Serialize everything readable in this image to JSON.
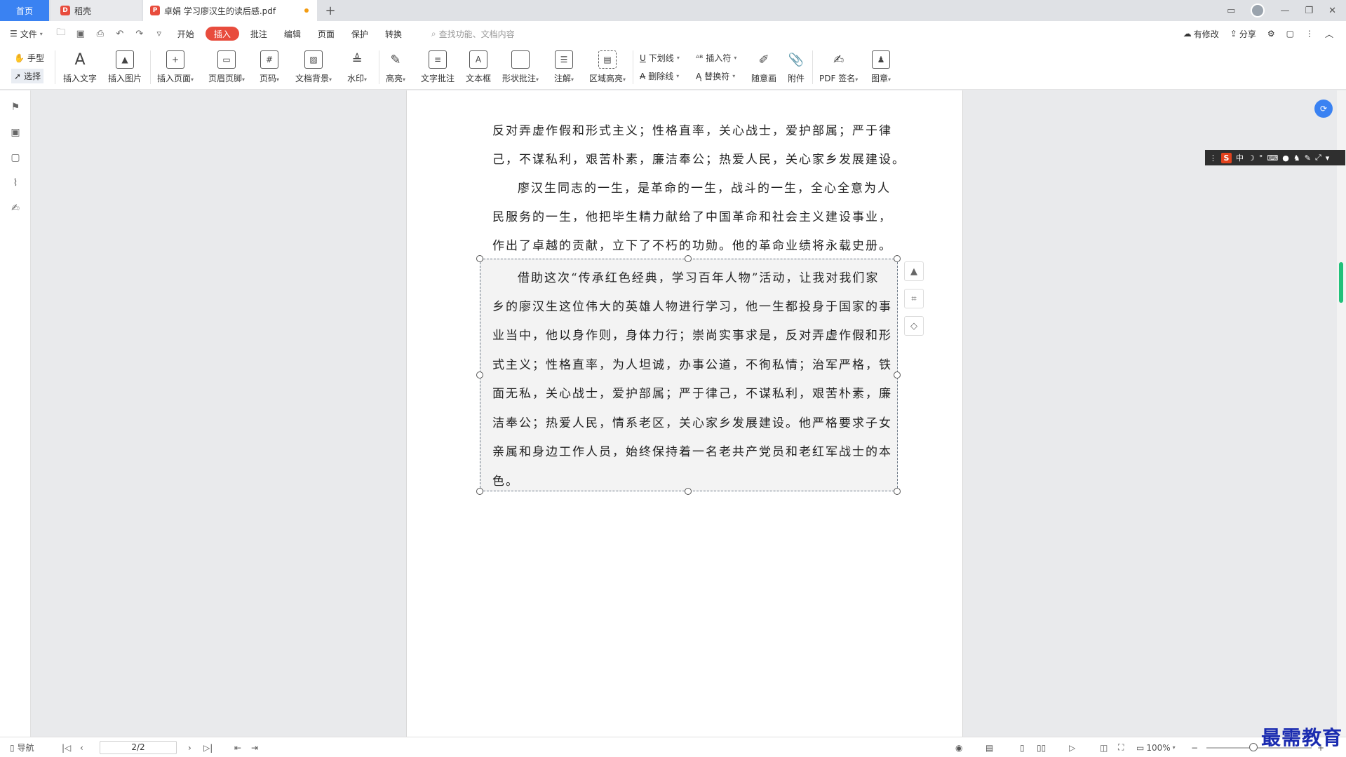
{
  "tabs": {
    "home": "首页",
    "inactive": "稻壳",
    "active": "卓娟 学习廖汉生的读后感.pdf",
    "new_tab": "+"
  },
  "menu": {
    "file": "文件",
    "items": [
      "开始",
      "插入",
      "批注",
      "编辑",
      "页面",
      "保护",
      "转换"
    ],
    "active_index": 1,
    "search_placeholder": "查找功能、文档内容",
    "modified": "有修改",
    "share": "分享"
  },
  "ribbon": {
    "hand": "手型",
    "select": "选择",
    "insert_text": "插入文字",
    "insert_image": "插入图片",
    "insert_page": "插入页面",
    "header_footer": "页眉页脚",
    "page_number": "页码",
    "doc_background": "文档背景",
    "watermark": "水印",
    "highlight": "高亮",
    "text_comment": "文字批注",
    "text_box": "文本框",
    "shape_comment": "形状批注",
    "annotation": "注解",
    "area_highlight": "区域高亮",
    "underline": "下划线",
    "strikethrough": "删除线",
    "insert_char": "插入符",
    "replace_char": "替换符",
    "freehand": "随意画",
    "attachment": "附件",
    "pdf_sign": "PDF 签名",
    "stamp": "图章"
  },
  "document": {
    "lines": [
      "反对弄虚作假和形式主义；性格直率，关心战士，爱护部属；严于律",
      "己，不谋私利，艰苦朴素，廉洁奉公；热爱人民，关心家乡发展建设。",
      "廖汉生同志的一生，是革命的一生，战斗的一生，全心全意为人",
      "民服务的一生，他把毕生精力献给了中国革命和社会主义建设事业，",
      "作出了卓越的贡献，立下了不朽的功勋。他的革命业绩将永载史册。"
    ],
    "selected_lines": [
      "借助这次“传承红色经典，学习百年人物”活动，让我对我们家",
      "乡的廖汉生这位伟大的英雄人物进行学习，他一生都投身于国家的事",
      "业当中，他以身作则，身体力行；崇尚实事求是，反对弄虚作假和形",
      "式主义；性格直率，为人坦诚，办事公道，不徇私情；治军严格，铁",
      "面无私，关心战士，爱护部属；严于律己，不谋私利，艰苦朴素，廉",
      "洁奉公；热爱人民，情系老区，关心家乡发展建设。他严格要求子女",
      "亲属和身边工作人员，始终保持着一名老共产党员和老红军战士的本",
      "色。"
    ]
  },
  "ime": {
    "logo": "S",
    "mode": "中"
  },
  "status": {
    "nav": "导航",
    "page": "2/2",
    "zoom": "100%",
    "zoom_level": 1.0
  },
  "watermark": "最需教育"
}
